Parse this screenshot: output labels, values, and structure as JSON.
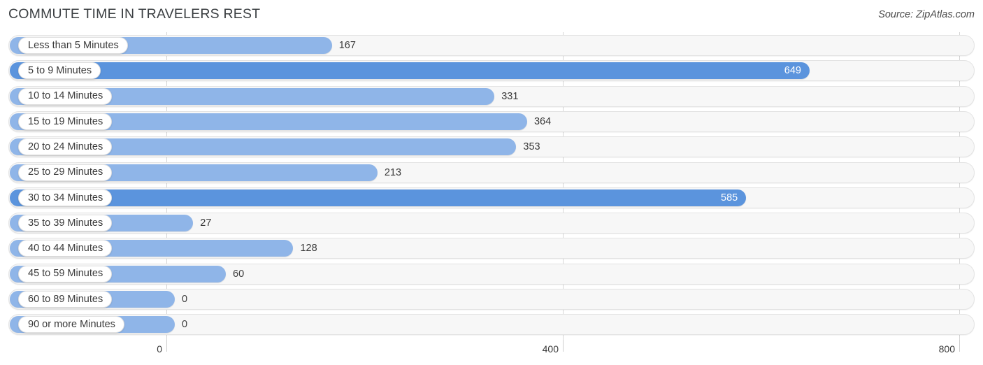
{
  "header": {
    "title": "COMMUTE TIME IN TRAVELERS REST",
    "source": "Source: ZipAtlas.com"
  },
  "chart_data": {
    "type": "bar",
    "orientation": "horizontal",
    "title": "COMMUTE TIME IN TRAVELERS REST",
    "xlabel": "",
    "ylabel": "",
    "xlim": [
      0,
      800
    ],
    "xticks": [
      0,
      400,
      800
    ],
    "xtick_labels": [
      "0",
      "400",
      "800"
    ],
    "grid": true,
    "legend": false,
    "categories": [
      "Less than 5 Minutes",
      "5 to 9 Minutes",
      "10 to 14 Minutes",
      "15 to 19 Minutes",
      "20 to 24 Minutes",
      "25 to 29 Minutes",
      "30 to 34 Minutes",
      "35 to 39 Minutes",
      "40 to 44 Minutes",
      "45 to 59 Minutes",
      "60 to 89 Minutes",
      "90 or more Minutes"
    ],
    "values": [
      167,
      649,
      331,
      364,
      353,
      213,
      585,
      27,
      128,
      60,
      0,
      0
    ],
    "value_labels": [
      "167",
      "649",
      "331",
      "364",
      "353",
      "213",
      "585",
      "27",
      "128",
      "60",
      "0",
      "0"
    ],
    "highlighted": [
      false,
      true,
      false,
      false,
      false,
      false,
      true,
      false,
      false,
      false,
      false,
      false
    ],
    "colors": {
      "bar": "#8fb5e8",
      "bar_highlight": "#5b94dd",
      "track": "#f7f7f7",
      "track_border": "#e3e3e3",
      "gridline": "#d6d6d6",
      "text": "#3a3a3a",
      "value_text_inside": "#ffffff"
    }
  }
}
